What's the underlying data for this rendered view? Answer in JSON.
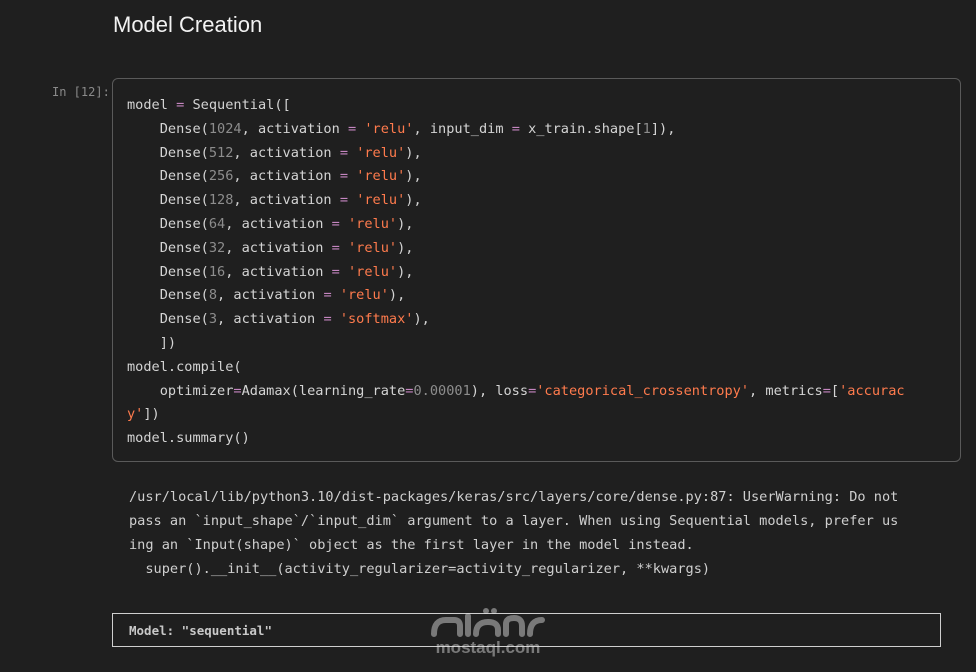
{
  "heading": "Model Creation",
  "cell": {
    "prompt": "In [12]:",
    "code_lines": [
      [
        {
          "t": "plain",
          "v": "model "
        },
        {
          "t": "op",
          "v": "="
        },
        {
          "t": "plain",
          "v": " Sequential(["
        }
      ],
      [
        {
          "t": "plain",
          "v": "    Dense("
        },
        {
          "t": "num",
          "v": "1024"
        },
        {
          "t": "plain",
          "v": ", activation "
        },
        {
          "t": "op",
          "v": "="
        },
        {
          "t": "plain",
          "v": " "
        },
        {
          "t": "str",
          "v": "'relu'"
        },
        {
          "t": "plain",
          "v": ", input_dim "
        },
        {
          "t": "op",
          "v": "="
        },
        {
          "t": "plain",
          "v": " x_train.shape["
        },
        {
          "t": "num",
          "v": "1"
        },
        {
          "t": "plain",
          "v": "]),"
        }
      ],
      [
        {
          "t": "plain",
          "v": "    Dense("
        },
        {
          "t": "num",
          "v": "512"
        },
        {
          "t": "plain",
          "v": ", activation "
        },
        {
          "t": "op",
          "v": "="
        },
        {
          "t": "plain",
          "v": " "
        },
        {
          "t": "str",
          "v": "'relu'"
        },
        {
          "t": "plain",
          "v": "),"
        }
      ],
      [
        {
          "t": "plain",
          "v": "    Dense("
        },
        {
          "t": "num",
          "v": "256"
        },
        {
          "t": "plain",
          "v": ", activation "
        },
        {
          "t": "op",
          "v": "="
        },
        {
          "t": "plain",
          "v": " "
        },
        {
          "t": "str",
          "v": "'relu'"
        },
        {
          "t": "plain",
          "v": "),"
        }
      ],
      [
        {
          "t": "plain",
          "v": "    Dense("
        },
        {
          "t": "num",
          "v": "128"
        },
        {
          "t": "plain",
          "v": ", activation "
        },
        {
          "t": "op",
          "v": "="
        },
        {
          "t": "plain",
          "v": " "
        },
        {
          "t": "str",
          "v": "'relu'"
        },
        {
          "t": "plain",
          "v": "),"
        }
      ],
      [
        {
          "t": "plain",
          "v": "    Dense("
        },
        {
          "t": "num",
          "v": "64"
        },
        {
          "t": "plain",
          "v": ", activation "
        },
        {
          "t": "op",
          "v": "="
        },
        {
          "t": "plain",
          "v": " "
        },
        {
          "t": "str",
          "v": "'relu'"
        },
        {
          "t": "plain",
          "v": "),"
        }
      ],
      [
        {
          "t": "plain",
          "v": "    Dense("
        },
        {
          "t": "num",
          "v": "32"
        },
        {
          "t": "plain",
          "v": ", activation "
        },
        {
          "t": "op",
          "v": "="
        },
        {
          "t": "plain",
          "v": " "
        },
        {
          "t": "str",
          "v": "'relu'"
        },
        {
          "t": "plain",
          "v": "),"
        }
      ],
      [
        {
          "t": "plain",
          "v": "    Dense("
        },
        {
          "t": "num",
          "v": "16"
        },
        {
          "t": "plain",
          "v": ", activation "
        },
        {
          "t": "op",
          "v": "="
        },
        {
          "t": "plain",
          "v": " "
        },
        {
          "t": "str",
          "v": "'relu'"
        },
        {
          "t": "plain",
          "v": "),"
        }
      ],
      [
        {
          "t": "plain",
          "v": "    Dense("
        },
        {
          "t": "num",
          "v": "8"
        },
        {
          "t": "plain",
          "v": ", activation "
        },
        {
          "t": "op",
          "v": "="
        },
        {
          "t": "plain",
          "v": " "
        },
        {
          "t": "str",
          "v": "'relu'"
        },
        {
          "t": "plain",
          "v": "),"
        }
      ],
      [
        {
          "t": "plain",
          "v": "    Dense("
        },
        {
          "t": "num",
          "v": "3"
        },
        {
          "t": "plain",
          "v": ", activation "
        },
        {
          "t": "op",
          "v": "="
        },
        {
          "t": "plain",
          "v": " "
        },
        {
          "t": "str",
          "v": "'softmax'"
        },
        {
          "t": "plain",
          "v": "),"
        }
      ],
      [
        {
          "t": "plain",
          "v": "    ])"
        }
      ],
      [
        {
          "t": "plain",
          "v": "model.compile("
        }
      ],
      [
        {
          "t": "plain",
          "v": "    optimizer"
        },
        {
          "t": "op",
          "v": "="
        },
        {
          "t": "plain",
          "v": "Adamax(learning_rate"
        },
        {
          "t": "op",
          "v": "="
        },
        {
          "t": "num",
          "v": "0.00001"
        },
        {
          "t": "plain",
          "v": "), loss"
        },
        {
          "t": "op",
          "v": "="
        },
        {
          "t": "str",
          "v": "'categorical_crossentropy'"
        },
        {
          "t": "plain",
          "v": ", metrics"
        },
        {
          "t": "op",
          "v": "="
        },
        {
          "t": "plain",
          "v": "["
        },
        {
          "t": "str",
          "v": "'accurac"
        }
      ],
      [
        {
          "t": "str",
          "v": "y'"
        },
        {
          "t": "plain",
          "v": "])"
        }
      ],
      [
        {
          "t": "plain",
          "v": "model.summary()"
        }
      ]
    ]
  },
  "output": {
    "lines": [
      "/usr/local/lib/python3.10/dist-packages/keras/src/layers/core/dense.py:87: UserWarning: Do not",
      "pass an `input_shape`/`input_dim` argument to a layer. When using Sequential models, prefer us",
      "ing an `Input(shape)` object as the first layer in the model instead.",
      "  super().__init__(activity_regularizer=activity_regularizer, **kwargs)"
    ]
  },
  "model_summary": {
    "label": "Model: \"sequential\""
  },
  "watermark": {
    "logo_text": "مستقل",
    "site": "mostaql.com"
  },
  "colors": {
    "background": "#1f1f1f",
    "keyword_operator": "#c586c0",
    "string": "#ff7b4d",
    "number": "#8d8d8d"
  }
}
